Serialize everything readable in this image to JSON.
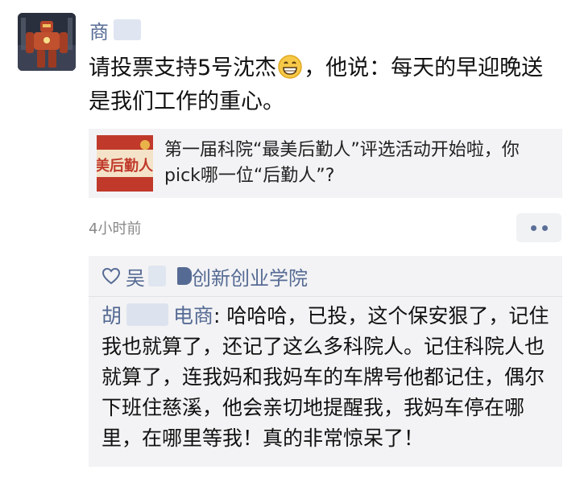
{
  "post": {
    "author": "商",
    "text_before_emoji": "请投票支持5号沈杰",
    "text_after_emoji": "，他说：每天的早迎晚送是我们工作的重心。",
    "emoji_icon": "grinning-face-icon"
  },
  "link_card": {
    "thumb_text": "美后勤人",
    "title": "第一届科院“最美后勤人”评选活动开始啦，你pick哪一位“后勤人”?"
  },
  "meta": {
    "timestamp": "4小时前"
  },
  "likes": {
    "liker_name": "吴",
    "liker_org": "创新创业学院"
  },
  "comment": {
    "author_first": "胡",
    "author_last": "电商",
    "separator": ": ",
    "text": "哈哈哈，已投，这个保安狠了，记住我也就算了，还记了这么多科院人。记住科院人也就算了，连我妈和我妈车的车牌号他都记住，偶尔下班住慈溪，他会亲切地提醒我，我妈车停在哪里，在哪里等我！真的非常惊呆了！"
  },
  "colors": {
    "link_blue": "#566b94",
    "card_bg": "#f3f3f5",
    "thumb_red": "#c0392b"
  }
}
